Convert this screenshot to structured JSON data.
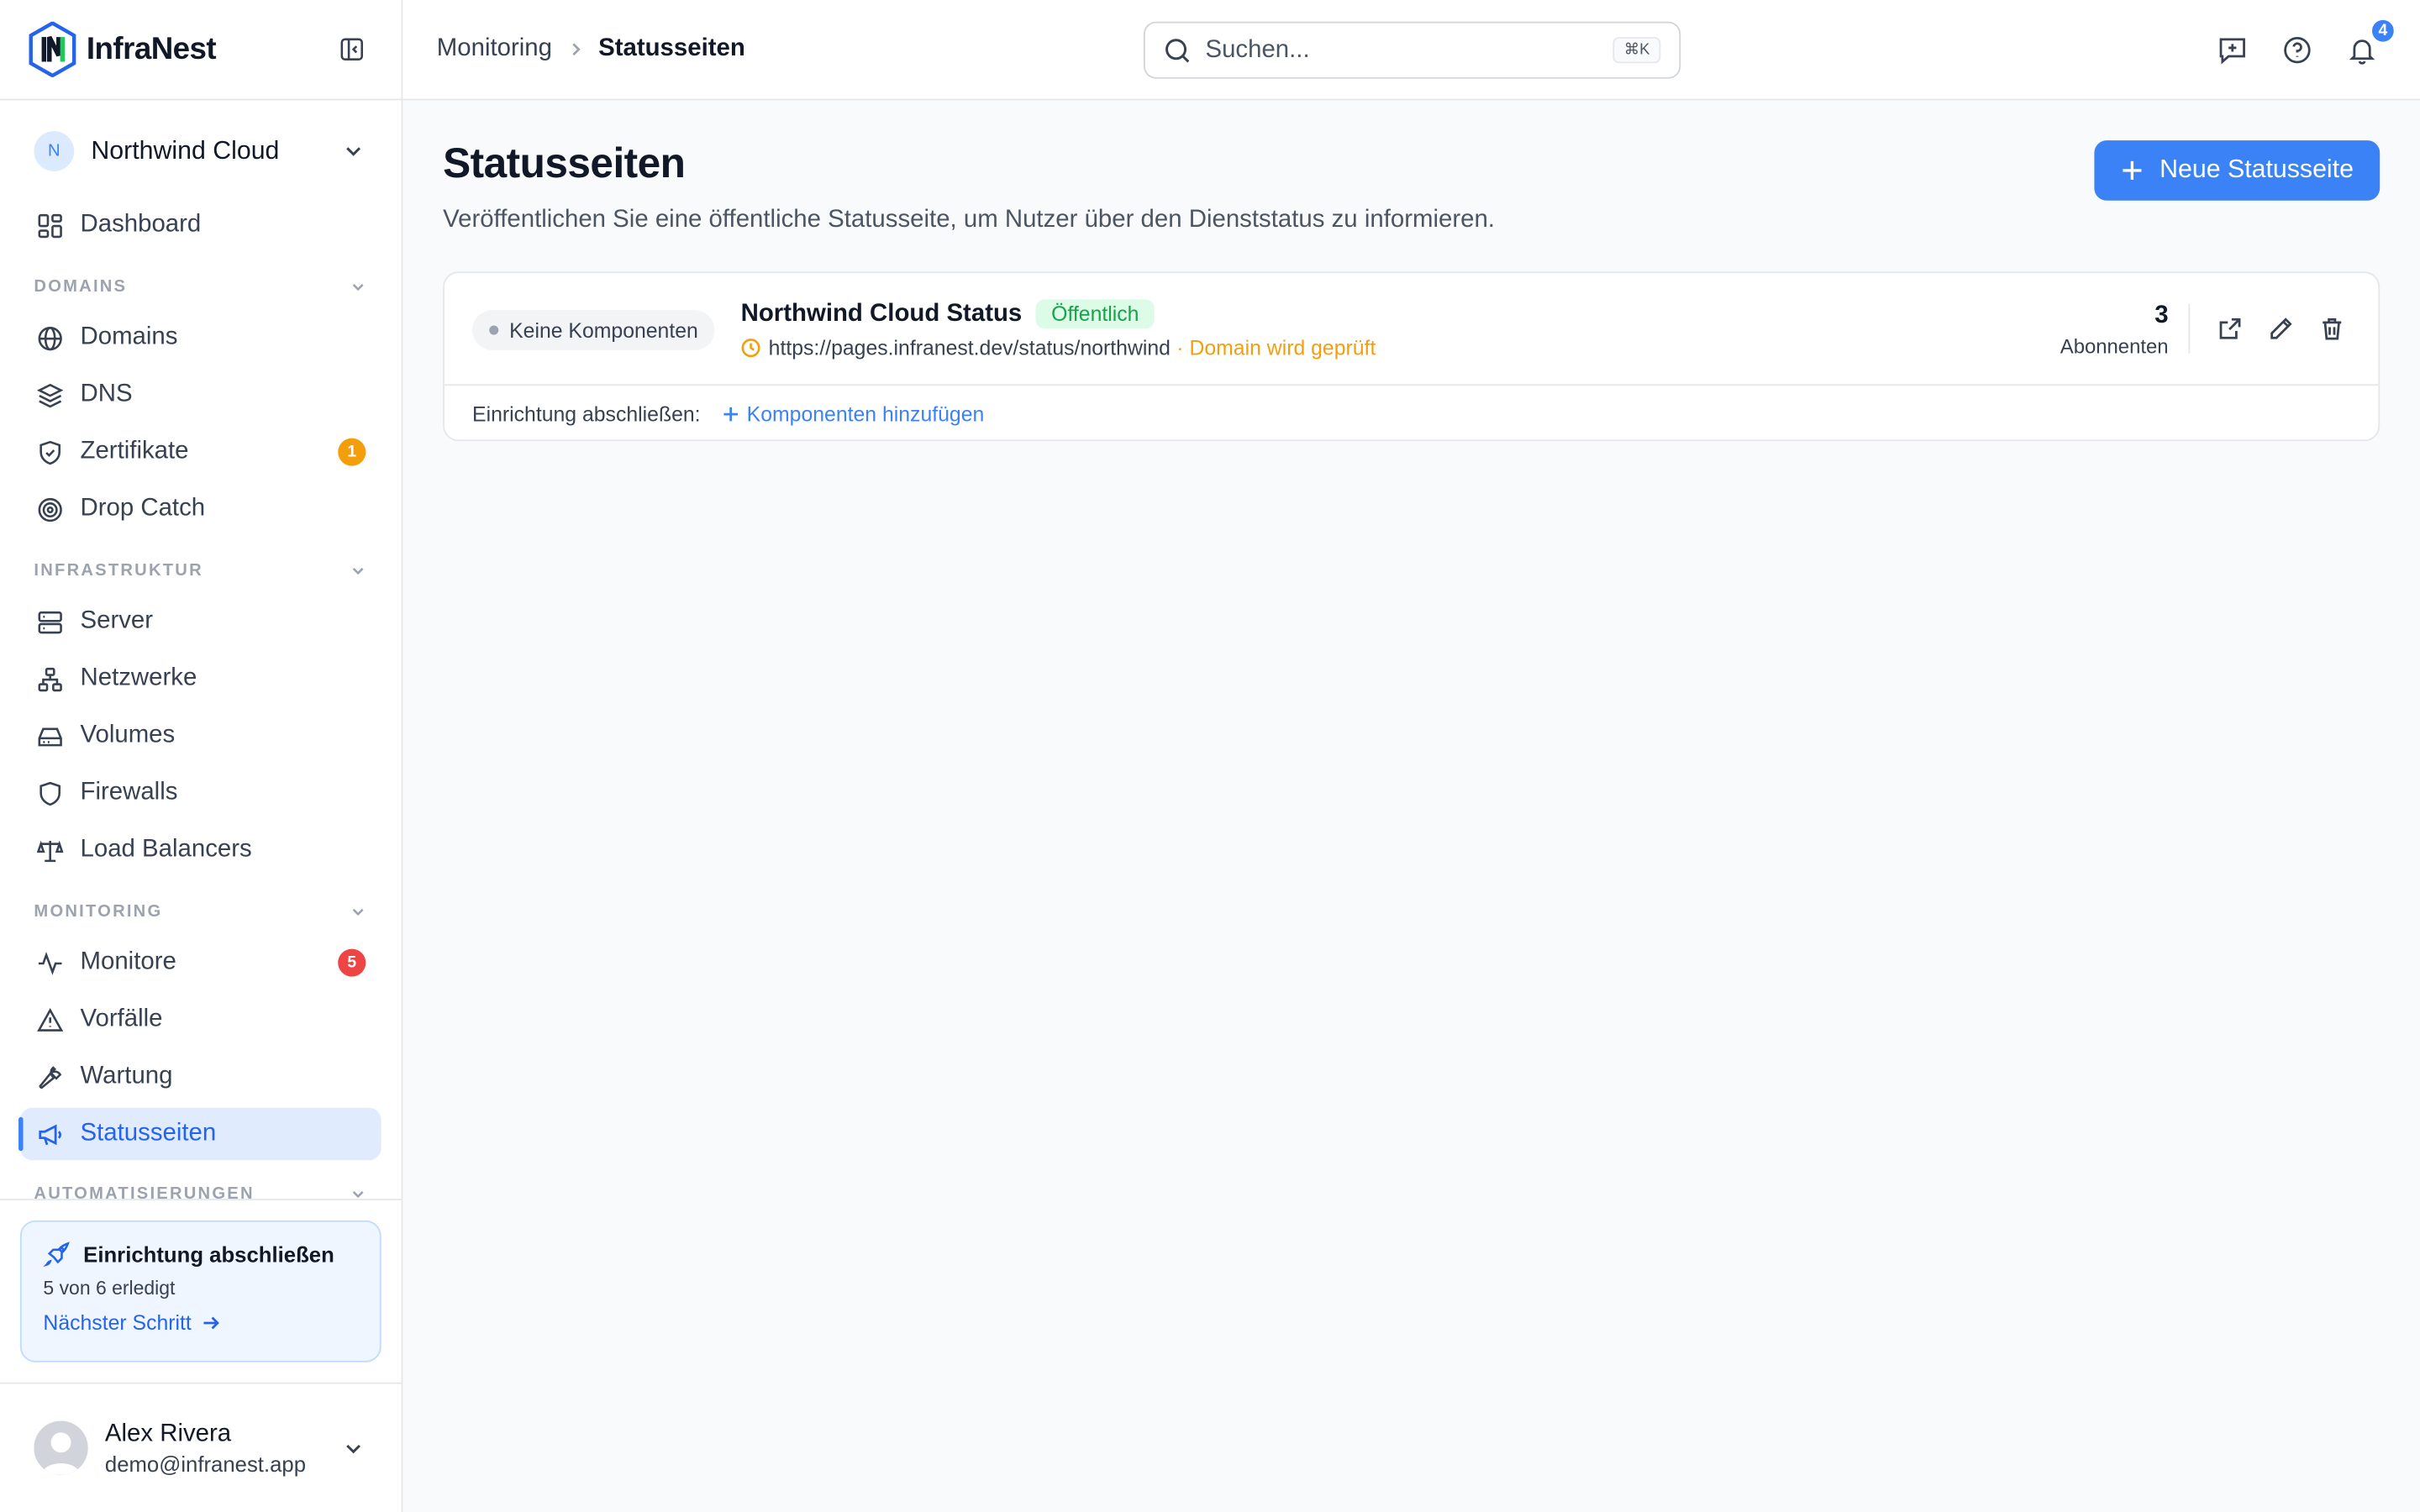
{
  "app": {
    "name": "InfraNest"
  },
  "org": {
    "initial": "N",
    "name": "Northwind Cloud"
  },
  "nav": {
    "dashboard": "Dashboard",
    "sections": {
      "domains": "DOMAINS",
      "infra": "INFRASTRUKTUR",
      "monitoring": "MONITORING",
      "automation": "AUTOMATISIERUNGEN"
    },
    "items": {
      "domains": "Domains",
      "dns": "DNS",
      "certs": "Zertifikate",
      "certs_badge": "1",
      "dropcatch": "Drop Catch",
      "server": "Server",
      "networks": "Netzwerke",
      "volumes": "Volumes",
      "firewalls": "Firewalls",
      "lb": "Load Balancers",
      "monitors": "Monitore",
      "monitors_badge": "5",
      "incidents": "Vorfälle",
      "maintenance": "Wartung",
      "statuspages": "Statusseiten"
    }
  },
  "setup": {
    "title": "Einrichtung abschließen",
    "progress": "5 von 6 erledigt",
    "next": "Nächster Schritt"
  },
  "user": {
    "name": "Alex Rivera",
    "email": "demo@infranest.app"
  },
  "topbar": {
    "breadcrumb_parent": "Monitoring",
    "breadcrumb_current": "Statusseiten",
    "search_placeholder": "Suchen...",
    "search_shortcut": "⌘K",
    "notif_count": "4"
  },
  "page": {
    "title": "Statusseiten",
    "description": "Veröffentlichen Sie eine öffentliche Statusseite, um Nutzer über den Dienststatus zu informieren.",
    "new_button": "Neue Statusseite"
  },
  "status_page": {
    "components_chip": "Keine Komponenten",
    "name": "Northwind Cloud Status",
    "visibility": "Öffentlich",
    "url": "https://pages.infranest.dev/status/northwind",
    "domain_status": "· Domain wird geprüft",
    "subscribers": "3",
    "subscribers_label": "Abonnenten",
    "setup_label": "Einrichtung abschließen:",
    "add_components": "Komponenten hinzufügen"
  },
  "colors": {
    "accent": "#3b82f6",
    "badge_warning": "#f59e0b",
    "badge_danger": "#ef4444",
    "success": "#16a34a"
  }
}
